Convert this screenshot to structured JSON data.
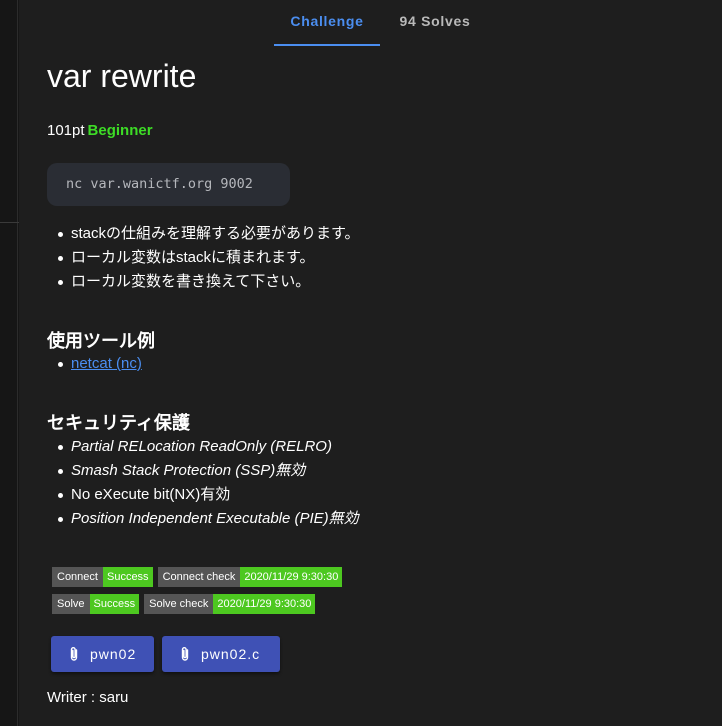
{
  "tabs": [
    {
      "label": "Challenge",
      "active": true
    },
    {
      "label": "94 Solves",
      "active": false
    }
  ],
  "challenge": {
    "title": "var rewrite",
    "points": "101pt",
    "difficulty": "Beginner",
    "command": "nc var.wanictf.org 9002",
    "notes": [
      "stackの仕組みを理解する必要があります。",
      "ローカル変数はstackに積まれます。",
      "ローカル変数を書き換えて下さい。"
    ],
    "tools_heading": "使用ツール例",
    "tools": [
      "netcat (nc)"
    ],
    "security_heading": "セキュリティ保護",
    "security": [
      {
        "text": "Partial RELocation ReadOnly (RELRO)",
        "italic": true
      },
      {
        "text": "Smash Stack Protection (SSP)無効",
        "italic": true
      },
      {
        "text": "No eXecute bit(NX)有効",
        "italic": false
      },
      {
        "text": "Position Independent Executable (PIE)無効",
        "italic": true
      }
    ],
    "writer": "Writer : saru"
  },
  "badges": {
    "connect": {
      "label": "Connect",
      "value": "Success"
    },
    "connect_check": {
      "label": "Connect check",
      "value": "2020/11/29 9:30:30"
    },
    "solve": {
      "label": "Solve",
      "value": "Success"
    },
    "solve_check": {
      "label": "Solve check",
      "value": "2020/11/29 9:30:30"
    }
  },
  "files": [
    {
      "label": "pwn02",
      "icon": "paperclip-icon"
    },
    {
      "label": "pwn02.c",
      "icon": "paperclip-icon"
    }
  ],
  "colors": {
    "background": "#1e1e1e",
    "accent": "#4b8ef0",
    "difficulty": "#3ddc26",
    "badge_success": "#4dc820",
    "button": "#3f51b5"
  }
}
